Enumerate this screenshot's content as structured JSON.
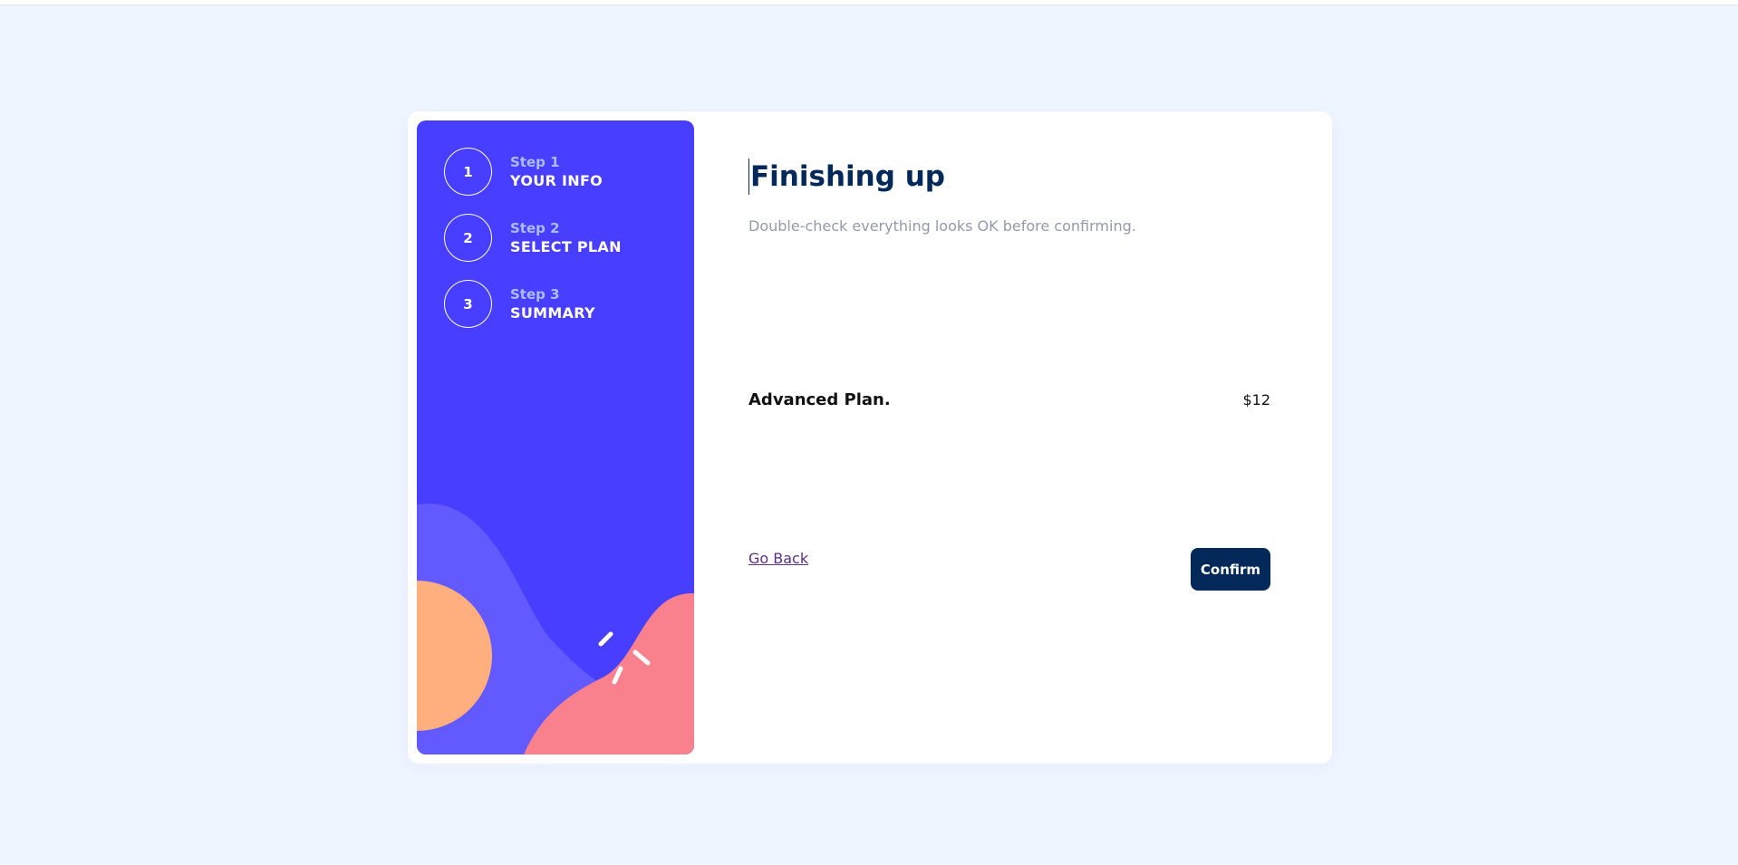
{
  "steps": [
    {
      "number": "1",
      "kicker": "Step 1",
      "title": "YOUR INFO"
    },
    {
      "number": "2",
      "kicker": "Step 2",
      "title": "SELECT PLAN"
    },
    {
      "number": "3",
      "kicker": "Step 3",
      "title": "SUMMARY"
    }
  ],
  "main": {
    "title": "Finishing up",
    "subtitle": "Double-check everything looks OK before confirming.",
    "plan_name": "Advanced Plan.",
    "plan_price": "$12",
    "back_label": "Go Back",
    "confirm_label": "Confirm"
  },
  "colors": {
    "sidebar": "#483eff",
    "primary": "#02295a",
    "orange": "#ffaf7e",
    "pink": "#f9818e",
    "violet": "#6259ff",
    "page_bg": "#eff5ff"
  }
}
